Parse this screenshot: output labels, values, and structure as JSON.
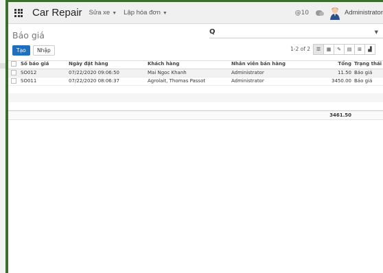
{
  "navbar": {
    "brand": "Car Repair",
    "menus": [
      "Sửa xe",
      "Lập hóa đơn"
    ],
    "activity_count": "@10",
    "user": "Administrator"
  },
  "control_panel": {
    "title": "Báo giá",
    "create": "Tạo",
    "import": "Nhập",
    "pager": "1-2 of 2",
    "search_placeholder": ""
  },
  "table": {
    "headers": {
      "number": "Số báo giá",
      "order_date": "Ngày đặt hàng",
      "customer": "Khách hàng",
      "salesperson": "Nhân viên bán hàng",
      "total": "Tổng",
      "status": "Trạng thái"
    },
    "rows": [
      {
        "number": "SO012",
        "order_date": "07/22/2020 09:06:50",
        "customer": "Mai Ngoc Khanh",
        "salesperson": "Administrator",
        "total": "11.50",
        "status": "Báo giá"
      },
      {
        "number": "SO011",
        "order_date": "07/22/2020 08:06:37",
        "customer": "Agrolait, Thomas Passot",
        "salesperson": "Administrator",
        "total": "3450.00",
        "status": "Báo giá"
      }
    ],
    "sum_total": "3461.50"
  },
  "colors": {
    "primary": "#1f6fbf",
    "frame": "#3c6e2e"
  }
}
